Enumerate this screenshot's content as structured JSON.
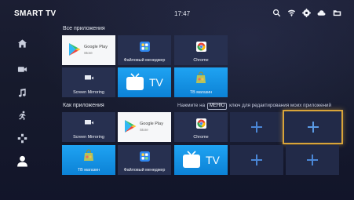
{
  "topbar": {
    "brand": "SMART TV",
    "clock": "17:47",
    "icons": [
      "search-icon",
      "signal-icon",
      "settings-icon",
      "cloud-icon",
      "folder-icon"
    ]
  },
  "sidebar": {
    "items": [
      {
        "name": "home-icon",
        "active": false
      },
      {
        "name": "video-icon",
        "active": false
      },
      {
        "name": "music-icon",
        "active": false
      },
      {
        "name": "sport-icon",
        "active": false
      },
      {
        "name": "games-icon",
        "active": false
      },
      {
        "name": "profile-icon",
        "active": true
      }
    ]
  },
  "all_apps": {
    "title": "Все приложения",
    "tiles": [
      {
        "label": "",
        "app": "Google Play",
        "sub": "Store"
      },
      {
        "label": "Файловый менеджер"
      },
      {
        "label": "Chrome"
      },
      {
        "label": "Screen Mirroring"
      },
      {
        "label": "",
        "app": "TV"
      },
      {
        "label": "TB магазин"
      }
    ]
  },
  "my_apps": {
    "title": "Как приложения",
    "hint_before": "Нажмите на",
    "hint_key": "МЕНЮ",
    "hint_after": "ключ для редактирования моих приложений",
    "tiles": [
      {
        "label": "Screen Mirroring"
      },
      {
        "label": "",
        "app": "Google Play",
        "sub": "Store"
      },
      {
        "label": "Chrome"
      },
      {
        "label": ""
      },
      {
        "label": "",
        "focused": true
      },
      {
        "label": "TB магазин"
      },
      {
        "label": "Файловый менеджер"
      },
      {
        "label": "",
        "app": "TV"
      },
      {
        "label": ""
      },
      {
        "label": ""
      }
    ]
  },
  "colors": {
    "accent_blue": "#1fa3f2",
    "focus_border": "#d8a43a",
    "background": "#161a2c"
  }
}
